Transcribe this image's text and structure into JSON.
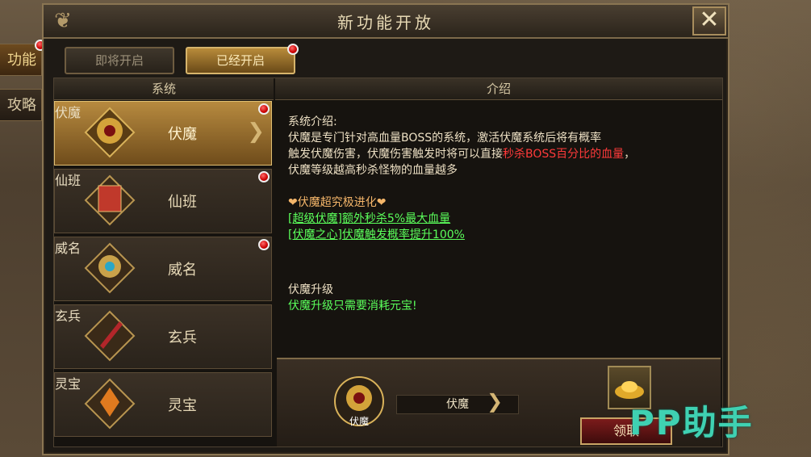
{
  "window": {
    "title": "新功能开放",
    "close_label": "✕"
  },
  "side_tabs": [
    {
      "label": "功能",
      "active": true,
      "badge": true
    },
    {
      "label": "攻略",
      "active": false,
      "badge": false
    }
  ],
  "tabs": [
    {
      "label": "即将开启",
      "active": false,
      "badge": false
    },
    {
      "label": "已经开启",
      "active": true,
      "badge": true
    }
  ],
  "columns": {
    "system": "系统",
    "intro": "介绍"
  },
  "systems": [
    {
      "label": "伏魔",
      "tag": "伏魔",
      "active": true,
      "badge": true,
      "color": "#d4a33a"
    },
    {
      "label": "仙班",
      "tag": "仙班",
      "active": false,
      "badge": true,
      "color": "#c0392b"
    },
    {
      "label": "威名",
      "tag": "威名",
      "active": false,
      "badge": true,
      "color": "#2aa7c7"
    },
    {
      "label": "玄兵",
      "tag": "玄兵",
      "active": false,
      "badge": false,
      "color": "#b3262a"
    },
    {
      "label": "灵宝",
      "tag": "灵宝",
      "active": false,
      "badge": false,
      "color": "#e07a1f"
    }
  ],
  "description": {
    "heading": "系统介绍:",
    "line1": "伏魔是专门针对高血量BOSS的系统，激活伏魔系统后将有概率",
    "line2_prefix": "触发伏魔伤害，伏魔伤害触发时将可以直接",
    "line2_highlight": "秒杀BOSS百分比的血量",
    "line2_suffix": "，",
    "line3": "伏魔等级越高秒杀怪物的血量越多",
    "evolve_title": "❤伏魔超究极进化❤",
    "evolve1": "[超级伏魔]额外秒杀5%最大血量",
    "evolve2": "[伏魔之心]伏魔触发概率提升100%",
    "upgrade_title": "伏魔升级",
    "upgrade_text": "伏魔升级只需要消耗元宝!"
  },
  "bottom": {
    "name": "伏魔",
    "tag": "伏魔",
    "claim_label": "领取"
  },
  "watermark": "PP助手"
}
